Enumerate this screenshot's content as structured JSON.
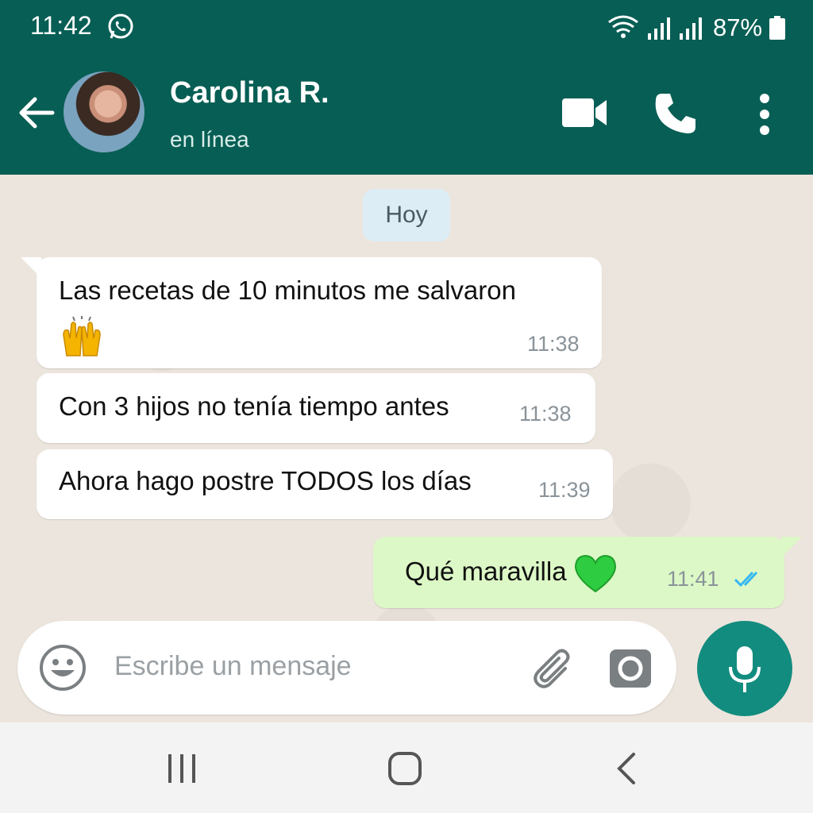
{
  "status_bar": {
    "time": "11:42",
    "battery": "87%",
    "icons": [
      "whatsapp-icon",
      "wifi-icon",
      "signal-icon",
      "signal-icon",
      "battery-icon"
    ]
  },
  "header": {
    "contact_name": "Carolina R.",
    "contact_status": "en línea",
    "icons": [
      "back-arrow-icon",
      "video-call-icon",
      "phone-call-icon",
      "more-options-icon"
    ]
  },
  "chat": {
    "date_chip": "Hoy",
    "messages": [
      {
        "direction": "incoming",
        "text": "Las recetas de 10 minutos me salvaron",
        "emoji": "raising-hands",
        "time": "11:38"
      },
      {
        "direction": "incoming",
        "text": "Con 3 hijos no tenía tiempo antes",
        "time": "11:38"
      },
      {
        "direction": "incoming",
        "text": "Ahora hago postre TODOS los días",
        "time": "11:39"
      },
      {
        "direction": "outgoing",
        "text": "Qué maravilla",
        "emoji": "green-heart",
        "time": "11:41",
        "read": true
      }
    ]
  },
  "composer": {
    "placeholder": "Escribe un mensaje",
    "icons": [
      "emoji-icon",
      "attach-icon",
      "camera-icon",
      "mic-icon"
    ]
  },
  "colors": {
    "header": "#075e54",
    "accent": "#128c7e",
    "outgoing_bubble": "#dcf8c6",
    "incoming_bubble": "#ffffff",
    "read_ticks": "#34b7f1",
    "chat_background": "#ece5dd"
  }
}
